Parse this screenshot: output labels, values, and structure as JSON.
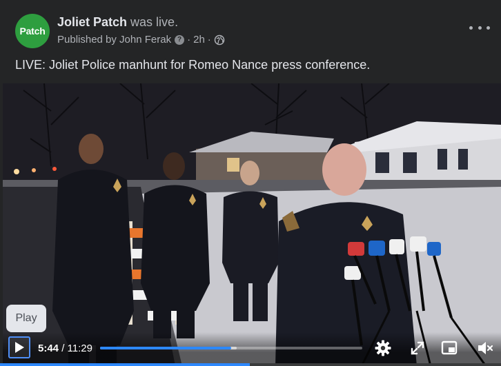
{
  "post": {
    "page_name": "Joliet Patch",
    "status": "was live.",
    "avatar_text": "Patch",
    "published_by": "Published by John Ferak",
    "help_mark": "?",
    "separator": "·",
    "age": "2h",
    "separator2": "·",
    "text": "LIVE: Joliet Police manhunt for Romeo Nance press conference."
  },
  "video": {
    "tooltip": "Play",
    "current_time": "5:44",
    "time_separator": " / ",
    "total_time": "11:29",
    "progress": 0.499,
    "buffered": 0.52
  },
  "icons": {
    "avatar": "patch-logo",
    "help": "question-circle-icon",
    "audience": "globe-icon",
    "more": "more-horizontal-icon",
    "play": "play-icon",
    "settings": "gear-icon",
    "fullscreen_expand": "expand-arrows-icon",
    "pip": "picture-in-picture-icon",
    "volume": "volume-muted-icon"
  },
  "colors": {
    "background": "#242526",
    "avatar_green": "#2e9e3f",
    "accent_blue": "#2d88ff",
    "primary_text": "#e4e6eb",
    "secondary_text": "#b0b3b8"
  }
}
